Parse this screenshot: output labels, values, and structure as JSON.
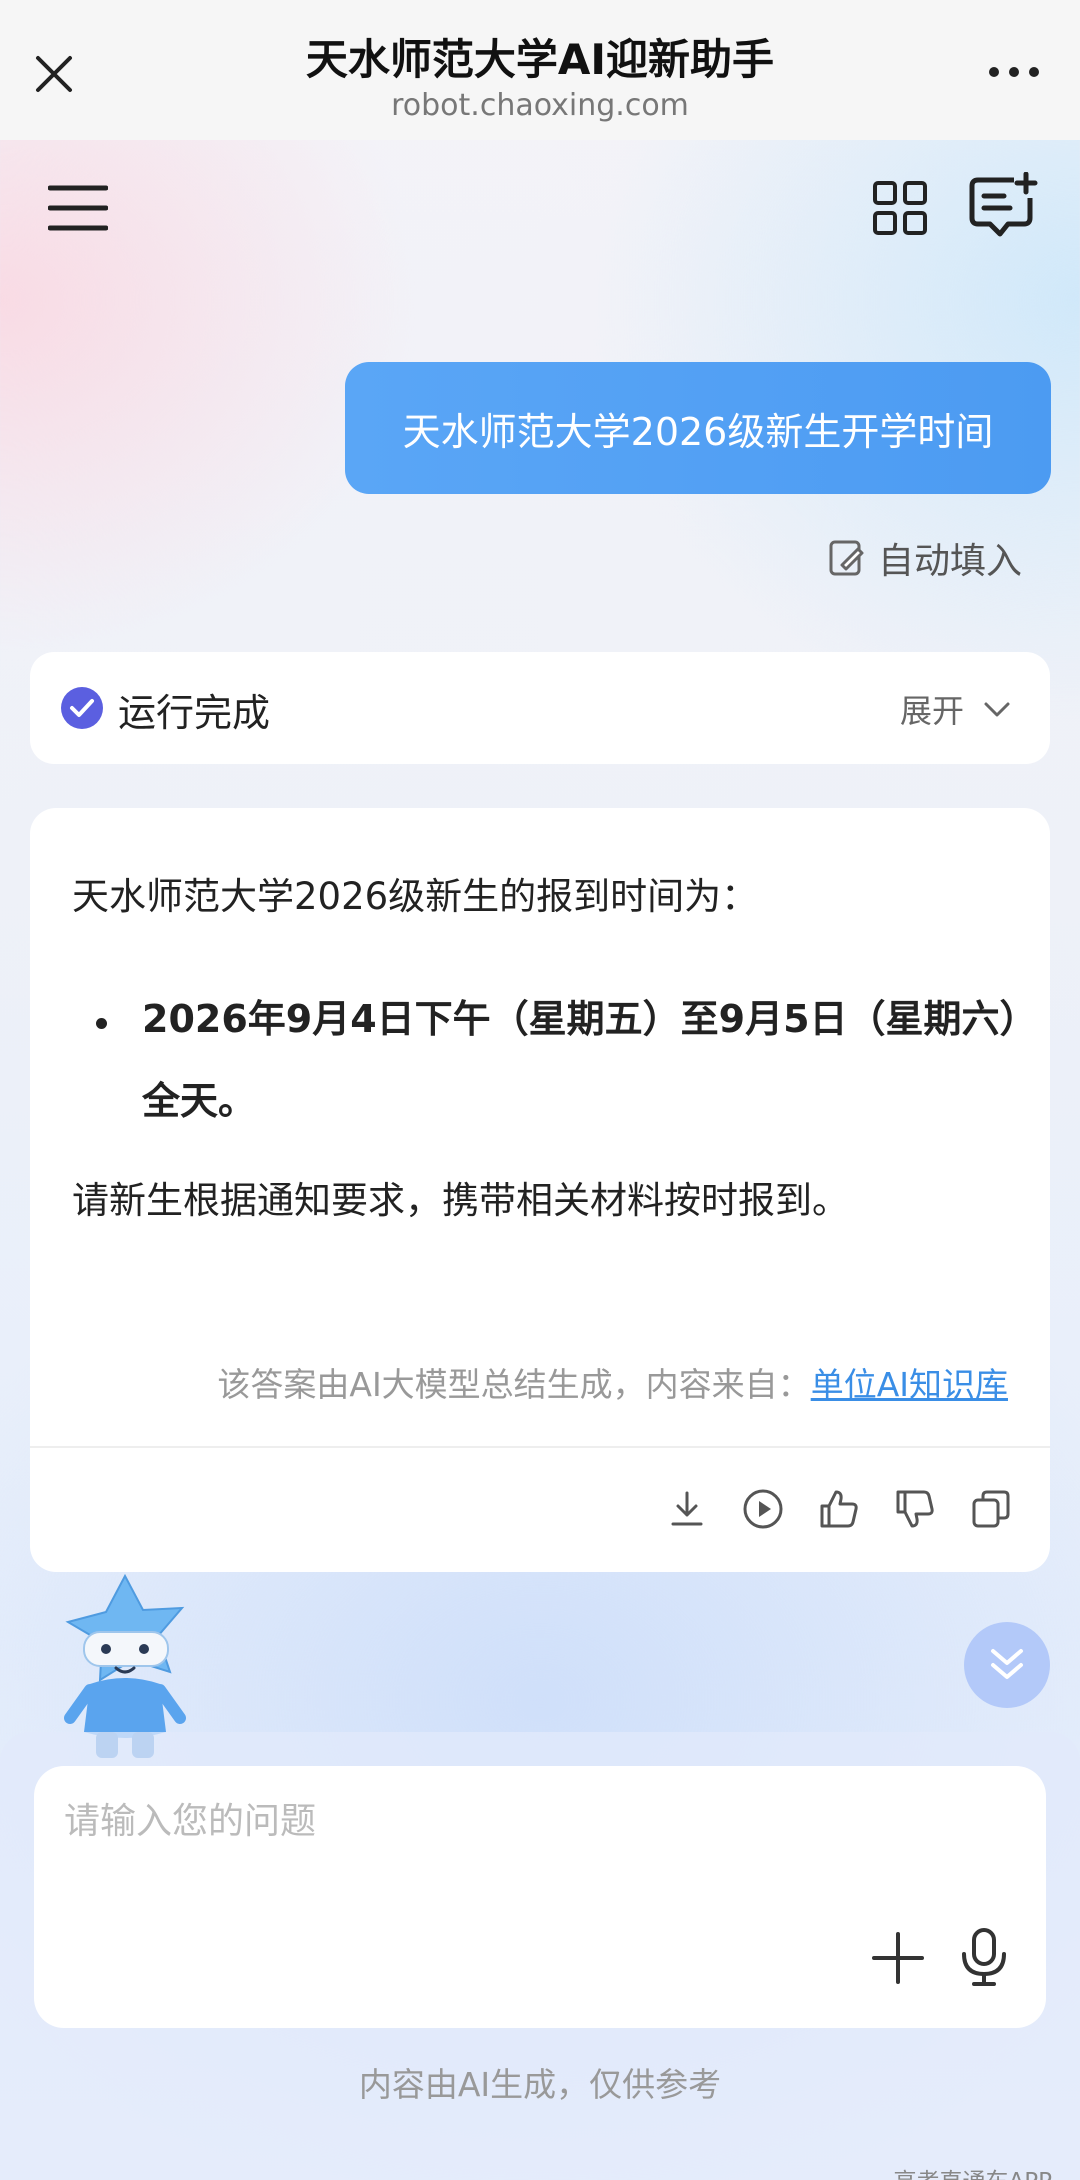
{
  "browser": {
    "title": "天水师范大学AI迎新助手",
    "url": "robot.chaoxing.com"
  },
  "chat": {
    "user_message": "天水师范大学2026级新生开学时间",
    "autofill_label": "自动填入",
    "run_status": "运行完成",
    "expand_label": "展开",
    "answer": {
      "intro": "天水师范大学2026级新生的报到时间为：",
      "bullet": "2026年9月4日下午（星期五）至9月5日（星期六）全天。",
      "notice": "请新生根据通知要求，携带相关材料按时报到。",
      "source_prefix": "该答案由AI大模型总结生成，内容来自：",
      "source_link": "单位AI知识库"
    },
    "actions": [
      "download-icon",
      "play-icon",
      "thumbs-up-icon",
      "thumbs-down-icon",
      "copy-icon"
    ]
  },
  "input": {
    "placeholder": "请输入您的问题",
    "value": ""
  },
  "disclaimer": "内容由AI生成，仅供参考",
  "watermark": "高考直通车APP",
  "colors": {
    "accent": "#4c9bf2",
    "link": "#3a8ee6",
    "check": "#5b5fe0"
  }
}
